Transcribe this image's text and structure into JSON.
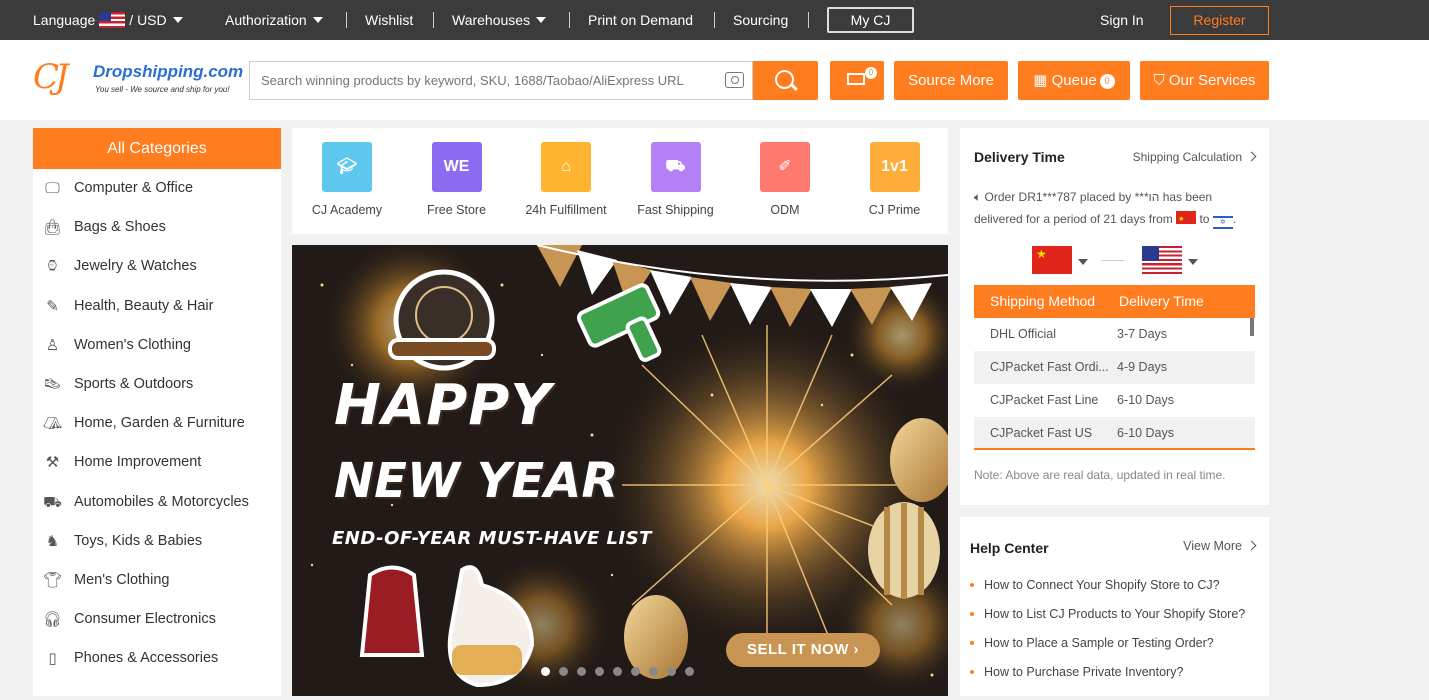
{
  "topbar": {
    "language": "Language",
    "currency": "/ USD",
    "authorization": "Authorization",
    "wishlist": "Wishlist",
    "warehouses": "Warehouses",
    "print_on_demand": "Print on Demand",
    "sourcing": "Sourcing",
    "my_cj": "My CJ",
    "sign_in": "Sign In",
    "register": "Register"
  },
  "header": {
    "logo_name": "Dropshipping.com",
    "logo_tagline": "You sell - We source and ship for you!",
    "search_placeholder": "Search winning products by keyword, SKU, 1688/Taobao/AliExpress URL",
    "cart_count": "0",
    "source_more": "Source More",
    "queue": "Queue",
    "queue_count": "0",
    "our_services": "Our Services"
  },
  "categories": {
    "title": "All Categories",
    "items": [
      {
        "label": "Computer & Office",
        "icon": "monitor-icon"
      },
      {
        "label": "Bags & Shoes",
        "icon": "bag-icon"
      },
      {
        "label": "Jewelry & Watches",
        "icon": "watch-icon"
      },
      {
        "label": "Health, Beauty & Hair",
        "icon": "brush-icon"
      },
      {
        "label": "Women's Clothing",
        "icon": "dress-icon"
      },
      {
        "label": "Sports & Outdoors",
        "icon": "sneaker-icon"
      },
      {
        "label": "Home, Garden & Furniture",
        "icon": "sofa-icon"
      },
      {
        "label": "Home Improvement",
        "icon": "paint-roller-icon"
      },
      {
        "label": "Automobiles & Motorcycles",
        "icon": "motorcycle-icon"
      },
      {
        "label": "Toys, Kids & Babies",
        "icon": "rocking-horse-icon"
      },
      {
        "label": "Men's Clothing",
        "icon": "shirt-icon"
      },
      {
        "label": "Consumer Electronics",
        "icon": "headphones-icon"
      },
      {
        "label": "Phones & Accessories",
        "icon": "phone-icon"
      }
    ]
  },
  "quick_links": [
    {
      "label": "CJ Academy",
      "icon": "graduation-cap-icon",
      "color": "#5ec7ee"
    },
    {
      "label": "Free Store",
      "icon": "we-store-icon",
      "color": "#8b6cf0"
    },
    {
      "label": "24h Fulfillment",
      "icon": "house-icon",
      "color": "#ffb531"
    },
    {
      "label": "Fast Shipping",
      "icon": "truck-icon",
      "color": "#b57ff5"
    },
    {
      "label": "ODM",
      "icon": "ruler-pencil-icon",
      "color": "#ff7a6e"
    },
    {
      "label": "CJ Prime",
      "icon": "prime-badge-icon",
      "color": "#ffad3a"
    }
  ],
  "banner": {
    "headline_1": "HAPPY",
    "headline_2": "NEW YEAR",
    "subtitle": "END-OF-YEAR MUST-HAVE LIST",
    "cta": "SELL IT NOW",
    "slides_total": 9,
    "active_slide": 1
  },
  "delivery": {
    "title": "Delivery Time",
    "calc_link": "Shipping Calculation",
    "message_1": "Order DR1***787 placed by ***הו has been delivered for a period of 21 days from",
    "message_to": "to",
    "from_country": "China",
    "to_country": "United States",
    "table_headers": [
      "Shipping Method",
      "Delivery Time"
    ],
    "rows": [
      {
        "method": "DHL Official",
        "time": "3-7 Days"
      },
      {
        "method": "CJPacket Fast Ordi...",
        "time": "4-9 Days"
      },
      {
        "method": "CJPacket Fast Line",
        "time": "6-10 Days"
      },
      {
        "method": "CJPacket Fast US",
        "time": "6-10 Days"
      }
    ],
    "note": "Note: Above are real data, updated in real time."
  },
  "help": {
    "title": "Help Center",
    "more": "View More",
    "links": [
      "How to Connect Your Shopify Store to CJ?",
      "How to List CJ Products to Your Shopify Store?",
      "How to Place a Sample or Testing Order?",
      "How to Purchase Private Inventory?"
    ]
  },
  "colors": {
    "accent": "#ff7c1f",
    "topbar": "#3b3b3b"
  }
}
